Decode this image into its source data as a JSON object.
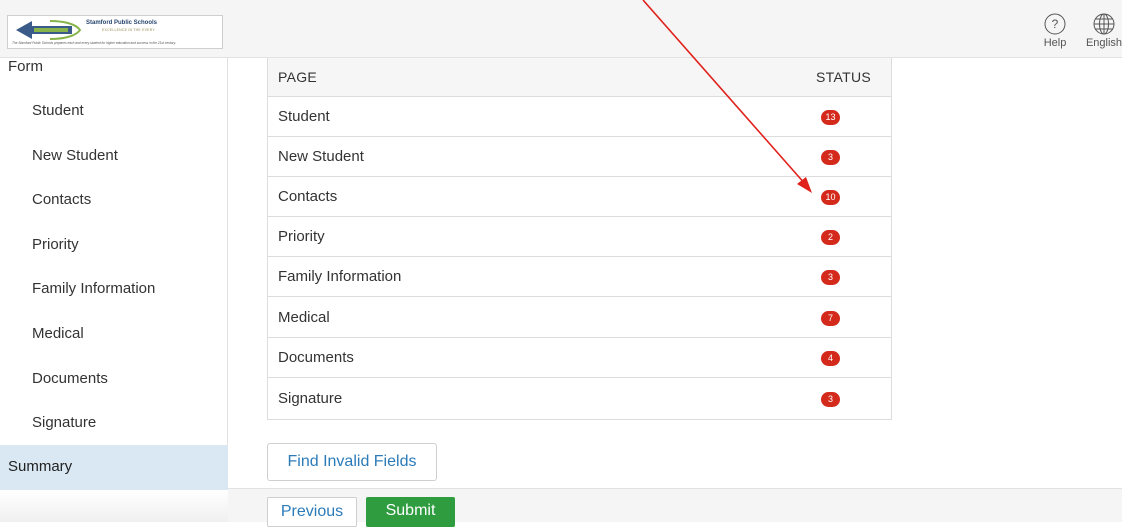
{
  "logo": {
    "title": "Stamford Public Schools",
    "subtitle": "EXCELLENCE IN THE EVERY",
    "tagline": "The Stamford Public Schools prepares each and every student for higher education and success in the 21st century."
  },
  "top_actions": {
    "help_label": "Help",
    "language_label": "English"
  },
  "sidebar": {
    "header": "Form",
    "items": [
      {
        "label": "Student"
      },
      {
        "label": "New Student"
      },
      {
        "label": "Contacts"
      },
      {
        "label": "Priority"
      },
      {
        "label": "Family Information"
      },
      {
        "label": "Medical"
      },
      {
        "label": "Documents"
      },
      {
        "label": "Signature"
      }
    ],
    "active_item": "Summary"
  },
  "table": {
    "col_page": "PAGE",
    "col_status": "STATUS",
    "rows": [
      {
        "page": "Student",
        "status": "13"
      },
      {
        "page": "New Student",
        "status": "3"
      },
      {
        "page": "Contacts",
        "status": "10"
      },
      {
        "page": "Priority",
        "status": "2"
      },
      {
        "page": "Family Information",
        "status": "3"
      },
      {
        "page": "Medical",
        "status": "7"
      },
      {
        "page": "Documents",
        "status": "4"
      },
      {
        "page": "Signature",
        "status": "3"
      }
    ]
  },
  "buttons": {
    "find_invalid": "Find Invalid Fields",
    "previous": "Previous",
    "submit": "Submit"
  },
  "colors": {
    "badge": "#d42a1c",
    "submit": "#2f9c3f",
    "link": "#2b7bb9",
    "active_nav": "#d9e8f2",
    "annotation_arrow": "#e0201a"
  }
}
